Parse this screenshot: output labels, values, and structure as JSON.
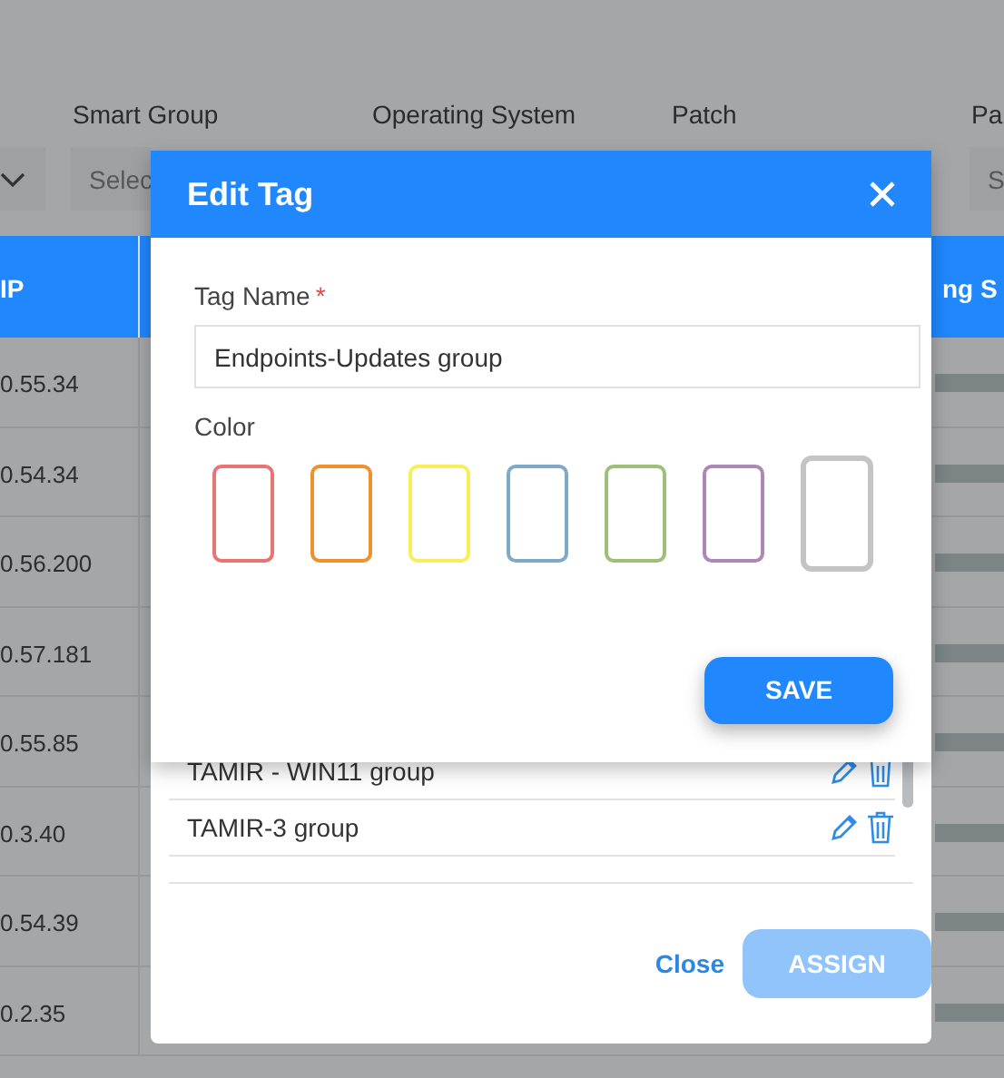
{
  "filters": [
    {
      "label": "Smart Group",
      "placeholder": "Selec"
    },
    {
      "label": "Operating System"
    },
    {
      "label": "Patch"
    },
    {
      "label": "Pa",
      "placeholder": "S"
    }
  ],
  "table": {
    "columns": [
      "IP",
      "ng S"
    ],
    "rows": [
      {
        "ip": "0.55.34"
      },
      {
        "ip": "0.54.34"
      },
      {
        "ip": "0.56.200"
      },
      {
        "ip": "0.57.181"
      },
      {
        "ip": "0.55.85"
      },
      {
        "ip": "0.3.40"
      },
      {
        "ip": "0.54.39"
      },
      {
        "ip": "0.2.35"
      }
    ]
  },
  "assign_dialog": {
    "tags": [
      {
        "name": "TAMIR - WIN11 group"
      },
      {
        "name": "TAMIR-3 group"
      }
    ],
    "close": "Close",
    "assign": {
      "label": "ASSIGN",
      "disabled": true
    }
  },
  "edit_dialog": {
    "title": "Edit Tag",
    "tag_name": {
      "label": "Tag Name",
      "required": true,
      "required_mark": "*",
      "value": "Endpoints-Updates group"
    },
    "color_label": "Color",
    "colors": [
      {
        "color": "#e87474",
        "selected": false
      },
      {
        "color": "#ef8f2e",
        "selected": false
      },
      {
        "color": "#f7ee5c",
        "selected": false
      },
      {
        "color": "#7fa9c9",
        "selected": false
      },
      {
        "color": "#9cc07a",
        "selected": false
      },
      {
        "color": "#ad88b6",
        "selected": false
      },
      {
        "color": "#c4c4c4",
        "selected": true
      }
    ],
    "save": "SAVE"
  }
}
